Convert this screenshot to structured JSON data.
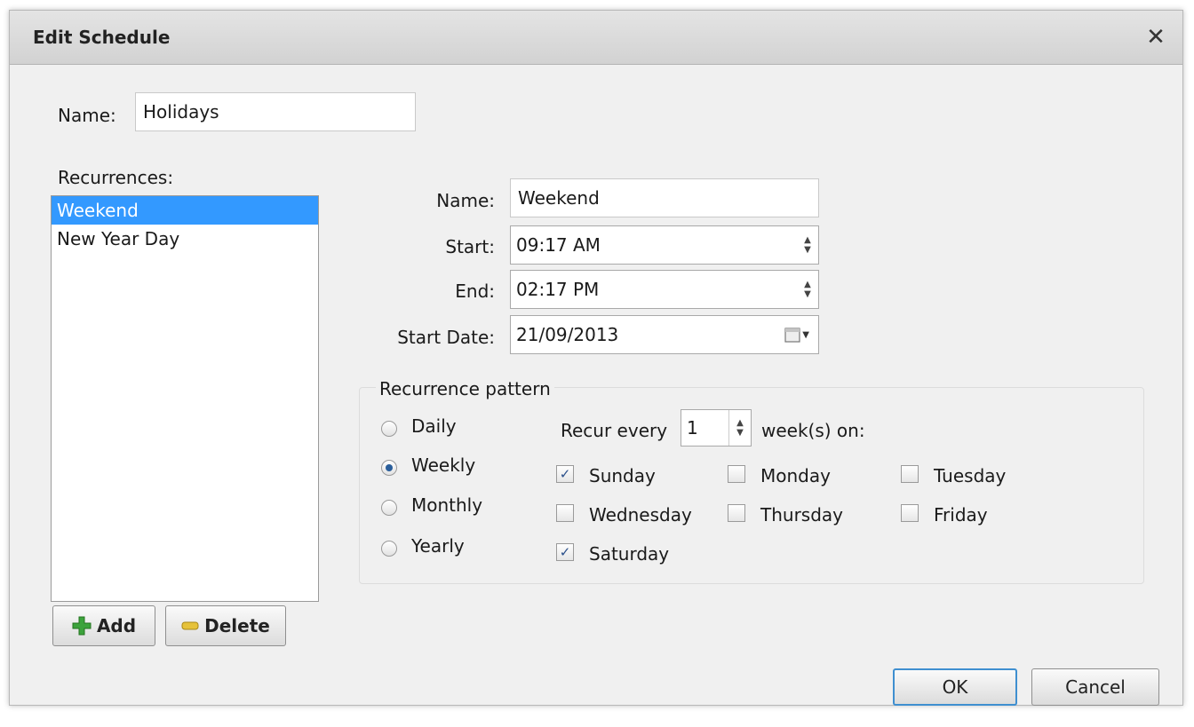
{
  "dialog": {
    "title": "Edit Schedule",
    "close_glyph": "✕"
  },
  "schedule": {
    "name_label": "Name:",
    "name_value": "Holidays"
  },
  "recurrences": {
    "label": "Recurrences:",
    "items": [
      {
        "label": "Weekend",
        "selected": true
      },
      {
        "label": "New Year Day",
        "selected": false
      }
    ],
    "add_label": "Add",
    "delete_label": "Delete"
  },
  "detail": {
    "name_label": "Name:",
    "name_value": "Weekend",
    "start_label": "Start:",
    "start_value": "09:17  AM",
    "end_label": "End:",
    "end_value": "02:17  PM",
    "start_date_label": "Start Date:",
    "start_date_value": "21/09/2013"
  },
  "pattern": {
    "title": "Recurrence pattern",
    "options": [
      {
        "label": "Daily",
        "checked": false
      },
      {
        "label": "Weekly",
        "checked": true
      },
      {
        "label": "Monthly",
        "checked": false
      },
      {
        "label": "Yearly",
        "checked": false
      }
    ],
    "recur_every_label": "Recur every",
    "recur_every_value": "1",
    "weeks_on_label": "week(s) on:",
    "days": [
      {
        "label": "Sunday",
        "checked": true
      },
      {
        "label": "Monday",
        "checked": false
      },
      {
        "label": "Tuesday",
        "checked": false
      },
      {
        "label": "Wednesday",
        "checked": false
      },
      {
        "label": "Thursday",
        "checked": false
      },
      {
        "label": "Friday",
        "checked": false
      },
      {
        "label": "Saturday",
        "checked": true
      }
    ]
  },
  "footer": {
    "ok_label": "OK",
    "cancel_label": "Cancel"
  },
  "colors": {
    "selection": "#3399ff",
    "add_icon": "#3ca33c",
    "delete_icon": "#e6c23a",
    "default_button_border": "#3f8fd0"
  }
}
